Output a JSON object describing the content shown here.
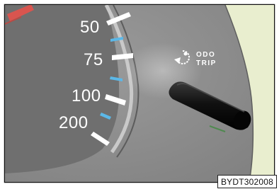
{
  "gauge": {
    "scale_labels": [
      "50",
      "75",
      "100",
      "200"
    ]
  },
  "odo_trip_icon": {
    "line1": "ODO",
    "line2": "TRIP"
  },
  "figure": {
    "code": "BYDT302008"
  },
  "colors": {
    "panel_gray": "#8a8a8a",
    "side_green": "#e9eecf",
    "tick_white": "#ffffff",
    "tick_blue": "#5bb8e8",
    "needle_red": "#d9554f",
    "knob_black": "#111111"
  }
}
